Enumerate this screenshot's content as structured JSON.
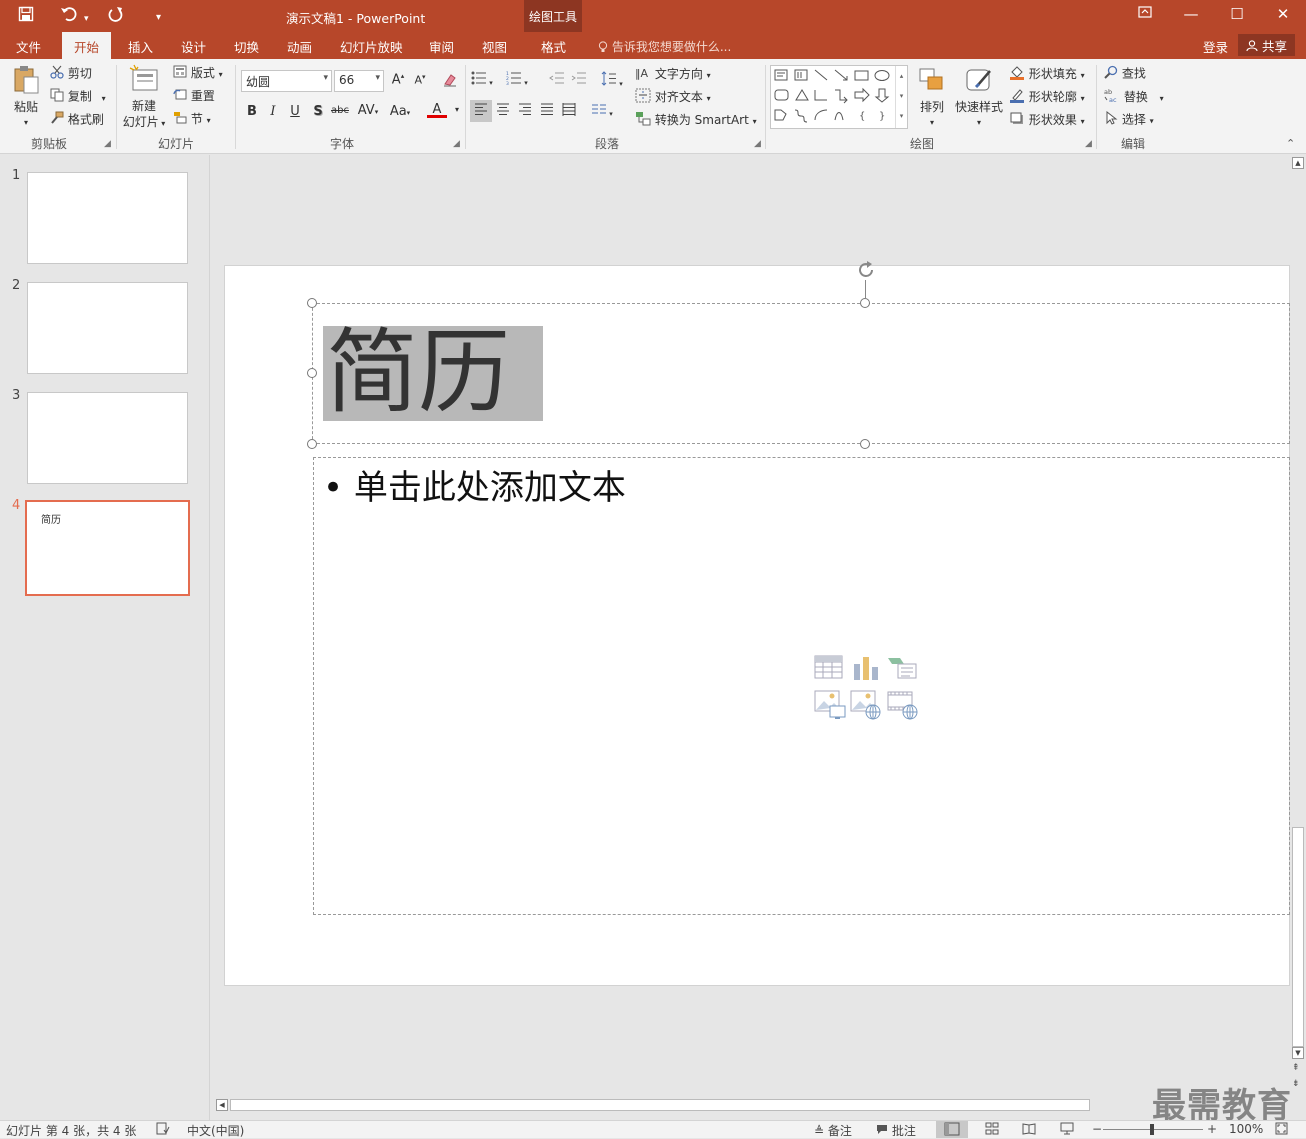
{
  "window": {
    "doc_title": "演示文稿1 - PowerPoint",
    "context_tools": "绘图工具"
  },
  "tabs": [
    {
      "label": "文件"
    },
    {
      "label": "开始"
    },
    {
      "label": "插入"
    },
    {
      "label": "设计"
    },
    {
      "label": "切换"
    },
    {
      "label": "动画"
    },
    {
      "label": "幻灯片放映"
    },
    {
      "label": "审阅"
    },
    {
      "label": "视图"
    },
    {
      "label": "格式"
    }
  ],
  "tell_me": "告诉我您想要做什么...",
  "account": {
    "login": "登录",
    "share": "共享"
  },
  "ribbon": {
    "clipboard": {
      "paste": "粘贴",
      "cut": "剪切",
      "copy": "复制",
      "format_painter": "格式刷",
      "label": "剪贴板"
    },
    "slides": {
      "new_slide_line1": "新建",
      "new_slide_line2": "幻灯片",
      "layout": "版式",
      "reset": "重置",
      "section": "节",
      "label": "幻灯片"
    },
    "font": {
      "font_name": "幼圆",
      "font_size": "66",
      "label": "字体"
    },
    "paragraph": {
      "text_direction": "文字方向",
      "align_text": "对齐文本",
      "smartart": "转换为 SmartArt",
      "label": "段落"
    },
    "drawing": {
      "arrange": "排列",
      "quick_styles": "快速样式",
      "shape_fill": "形状填充",
      "shape_outline": "形状轮廓",
      "shape_effects": "形状效果",
      "label": "绘图"
    },
    "editing": {
      "find": "查找",
      "replace": "替换",
      "select": "选择",
      "label": "编辑"
    }
  },
  "thumbnails": [
    {
      "num": "1",
      "text": ""
    },
    {
      "num": "2",
      "text": ""
    },
    {
      "num": "3",
      "text": ""
    },
    {
      "num": "4",
      "text": "简历"
    }
  ],
  "slide": {
    "title": "简历",
    "body_placeholder": "单击此处添加文本"
  },
  "status": {
    "slide_info": "幻灯片 第 4 张，共 4 张",
    "language": "中文(中国)",
    "notes": "备注",
    "comments": "批注",
    "zoom": "100%"
  },
  "watermark": "最需教育",
  "colors": {
    "accent": "#b7472a",
    "selected_thumb": "#e46c4f"
  }
}
